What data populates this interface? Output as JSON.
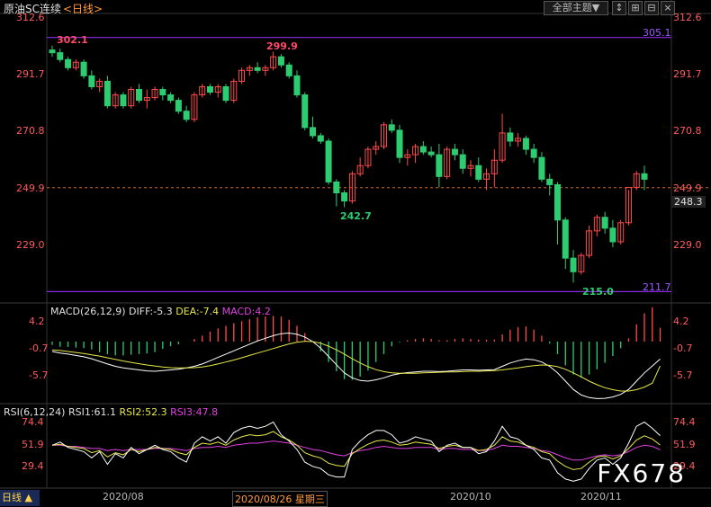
{
  "header": {
    "title": "原油SC连续",
    "period": "<日线>",
    "theme_button": "全部主题▼",
    "tool_icons": [
      "↕",
      "⊞",
      "⊟"
    ]
  },
  "price_panel": {
    "right_ticks": [
      "312.6",
      "291.7",
      "270.8",
      "249.9",
      "229.0"
    ],
    "left_ticks": [
      "312.6",
      "291.7",
      "270.8",
      "249.9",
      "229.0"
    ],
    "current_price_tag": "249.9",
    "last_price_tag": "248.3",
    "upper_line_label": "305.1",
    "lower_line_label": "211.7",
    "annotations": {
      "high1": "302.1",
      "high2": "299.9",
      "low1": "242.7",
      "low2": "215.0"
    }
  },
  "macd_panel": {
    "title": "MACD(26,12,9)",
    "diff": "DIFF:-5.3",
    "dea": "DEA:-7.4",
    "macd": "MACD:4.2",
    "ticks": [
      "4.2",
      "-0.7",
      "-5.7"
    ]
  },
  "rsi_panel": {
    "title": "RSI(6,12,24)",
    "rsi1": "RSI1:61.1",
    "rsi2": "RSI2:52.3",
    "rsi3": "RSI3:47.8",
    "ticks": [
      "74.4",
      "51.9",
      "29.4"
    ]
  },
  "footer": {
    "period_button": "日线 ▲",
    "dates": [
      "2020/08",
      "2020/08/26 星期三",
      "2020/10",
      "2020/11"
    ],
    "watermark": "FX678"
  },
  "colors": {
    "up": "#ff4a4a",
    "down": "#2ecc71",
    "diff": "#ffffff",
    "dea": "#e8e84a",
    "rsi3": "#e040e0",
    "line": "#8a2be2"
  },
  "chart_data": {
    "type": "candlestick",
    "title": "原油SC连续",
    "ylim": [
      205,
      315
    ],
    "candles": [
      [
        300.5,
        302.1,
        298,
        299.5
      ],
      [
        299.5,
        301,
        296,
        297
      ],
      [
        297,
        298,
        293,
        294
      ],
      [
        294,
        297,
        293,
        296
      ],
      [
        296,
        297,
        290,
        291
      ],
      [
        291,
        293,
        286,
        287
      ],
      [
        287,
        290,
        285,
        289
      ],
      [
        289,
        291,
        279,
        280
      ],
      [
        280,
        285,
        279,
        284
      ],
      [
        284,
        285,
        279,
        280
      ],
      [
        280,
        287,
        279,
        286
      ],
      [
        286,
        288,
        281,
        282
      ],
      [
        282,
        286,
        279,
        283
      ],
      [
        283,
        287,
        282,
        286
      ],
      [
        286,
        287,
        282,
        284
      ],
      [
        284,
        285,
        281,
        282
      ],
      [
        282,
        283,
        277,
        278
      ],
      [
        278,
        280,
        274,
        275
      ],
      [
        275,
        285,
        274,
        284
      ],
      [
        284,
        288,
        283,
        287
      ],
      [
        287,
        288,
        284,
        285
      ],
      [
        285,
        288,
        283,
        287
      ],
      [
        287,
        288,
        281,
        282
      ],
      [
        282,
        290,
        281,
        289
      ],
      [
        289,
        294,
        288,
        293
      ],
      [
        293,
        295,
        291,
        294
      ],
      [
        294,
        296,
        292,
        293
      ],
      [
        293,
        295,
        291,
        294
      ],
      [
        294,
        299.9,
        293,
        298
      ],
      [
        298,
        299,
        294,
        295
      ],
      [
        295,
        296,
        290,
        291
      ],
      [
        291,
        293,
        283,
        284
      ],
      [
        284,
        285,
        271,
        272
      ],
      [
        272,
        276,
        268,
        269
      ],
      [
        269,
        270,
        266,
        267
      ],
      [
        267,
        268,
        251,
        252
      ],
      [
        252,
        253,
        243,
        248
      ],
      [
        248,
        249,
        242.7,
        245
      ],
      [
        245,
        256,
        244,
        255
      ],
      [
        255,
        261,
        254,
        258
      ],
      [
        258,
        265,
        257,
        264
      ],
      [
        264,
        267,
        262,
        265
      ],
      [
        265,
        274,
        264,
        273
      ],
      [
        273,
        275,
        270,
        271
      ],
      [
        271,
        273,
        259,
        261
      ],
      [
        261,
        264,
        258,
        262
      ],
      [
        262,
        266,
        259,
        265
      ],
      [
        265,
        267,
        262,
        263
      ],
      [
        263,
        265,
        261,
        262
      ],
      [
        262,
        266,
        250,
        254
      ],
      [
        254,
        265,
        253,
        264
      ],
      [
        264,
        266,
        260,
        262
      ],
      [
        262,
        264,
        255,
        257
      ],
      [
        257,
        260,
        254,
        258
      ],
      [
        258,
        261,
        252,
        253
      ],
      [
        253,
        257,
        249,
        255
      ],
      [
        255,
        264,
        250,
        260
      ],
      [
        260,
        277,
        259,
        270
      ],
      [
        270,
        272,
        265,
        267
      ],
      [
        267,
        270,
        265,
        268
      ],
      [
        268,
        269,
        262,
        264
      ],
      [
        264,
        266,
        259,
        261
      ],
      [
        261,
        263,
        252,
        253
      ],
      [
        253,
        255,
        247,
        251
      ],
      [
        251,
        252,
        229,
        238
      ],
      [
        238,
        239,
        220,
        224
      ],
      [
        224,
        227,
        215,
        219
      ],
      [
        219,
        226,
        218,
        225
      ],
      [
        225,
        236,
        224,
        234
      ],
      [
        234,
        240,
        232,
        239
      ],
      [
        239,
        241,
        233,
        235
      ],
      [
        235,
        238,
        228,
        230
      ],
      [
        230,
        238,
        229,
        237
      ],
      [
        237,
        249,
        236,
        250
      ],
      [
        250,
        256,
        249,
        255
      ],
      [
        255,
        258,
        249,
        253
      ]
    ],
    "macd": {
      "diff": [
        -3.0,
        -3.5,
        -3.8,
        -4.2,
        -4.6,
        -5.2,
        -6.0,
        -6.8,
        -7.5,
        -8.0,
        -8.3,
        -8.6,
        -8.9,
        -9.0,
        -8.8,
        -8.6,
        -8.4,
        -8.0,
        -7.5,
        -6.8,
        -5.8,
        -4.8,
        -3.8,
        -2.8,
        -1.8,
        -0.8,
        0.2,
        1.0,
        1.8,
        2.4,
        2.6,
        2.2,
        1.4,
        0.0,
        -2.0,
        -4.5,
        -7.0,
        -9.5,
        -11.0,
        -11.8,
        -12.0,
        -11.6,
        -11.0,
        -10.2,
        -9.7,
        -9.4,
        -9.2,
        -9.0,
        -9.0,
        -9.1,
        -9.0,
        -8.8,
        -8.6,
        -8.6,
        -8.7,
        -8.6,
        -8.5,
        -7.5,
        -6.5,
        -5.8,
        -5.3,
        -5.5,
        -6.2,
        -7.5,
        -9.5,
        -12.0,
        -14.5,
        -16.2,
        -17.0,
        -17.3,
        -17.2,
        -16.8,
        -16.0,
        -14.5,
        -12.0,
        -9.5,
        -7.4,
        -5.3
      ],
      "dea": [
        -2.5,
        -2.7,
        -3.0,
        -3.3,
        -3.6,
        -4.0,
        -4.4,
        -4.9,
        -5.4,
        -5.9,
        -6.3,
        -6.7,
        -7.1,
        -7.4,
        -7.7,
        -7.9,
        -8.0,
        -8.0,
        -7.9,
        -7.7,
        -7.3,
        -6.8,
        -6.2,
        -5.6,
        -4.9,
        -4.2,
        -3.5,
        -2.8,
        -2.1,
        -1.4,
        -0.7,
        -0.2,
        0.1,
        0.0,
        -0.5,
        -1.4,
        -2.5,
        -3.8,
        -5.2,
        -6.5,
        -7.6,
        -8.5,
        -9.1,
        -9.5,
        -9.6,
        -9.6,
        -9.6,
        -9.5,
        -9.4,
        -9.3,
        -9.2,
        -9.2,
        -9.1,
        -9.0,
        -9.0,
        -8.9,
        -8.8,
        -8.6,
        -8.3,
        -8.0,
        -7.6,
        -7.3,
        -7.1,
        -7.2,
        -7.6,
        -8.4,
        -9.5,
        -10.7,
        -12.0,
        -13.1,
        -14.0,
        -14.6,
        -15.0,
        -15.0,
        -14.6,
        -13.8,
        -12.6,
        -7.4
      ],
      "hist": [
        -1.0,
        -1.6,
        -1.6,
        -1.8,
        -2.0,
        -2.4,
        -3.2,
        -3.8,
        -4.2,
        -4.2,
        -4.0,
        -3.8,
        -3.6,
        -3.2,
        -2.2,
        -1.4,
        -0.8,
        0.0,
        0.8,
        1.8,
        3.0,
        4.0,
        4.8,
        5.6,
        6.2,
        6.8,
        7.4,
        7.6,
        7.8,
        7.6,
        6.6,
        4.8,
        2.6,
        0.0,
        -3.0,
        -6.2,
        -9.0,
        -11.4,
        -11.6,
        -10.6,
        -8.8,
        -6.2,
        -3.8,
        -1.4,
        -0.2,
        0.4,
        0.8,
        1.0,
        0.8,
        0.4,
        0.4,
        0.8,
        1.0,
        0.8,
        0.6,
        0.6,
        0.6,
        2.2,
        3.6,
        4.4,
        4.6,
        3.6,
        1.8,
        -0.6,
        -3.8,
        -7.2,
        -10.0,
        -11.0,
        -10.0,
        -8.4,
        -6.4,
        -4.4,
        -2.0,
        1.0,
        5.2,
        8.6,
        10.4,
        4.2
      ]
    },
    "rsi": {
      "rsi1": [
        52,
        55,
        50,
        48,
        46,
        40,
        46,
        34,
        44,
        40,
        50,
        44,
        48,
        52,
        48,
        46,
        40,
        36,
        54,
        60,
        56,
        60,
        54,
        64,
        68,
        70,
        68,
        70,
        74,
        62,
        56,
        48,
        36,
        32,
        30,
        24,
        22,
        22,
        48,
        56,
        62,
        66,
        66,
        62,
        54,
        56,
        60,
        58,
        56,
        46,
        52,
        54,
        50,
        50,
        44,
        46,
        56,
        70,
        60,
        58,
        52,
        48,
        40,
        38,
        26,
        20,
        18,
        20,
        30,
        38,
        40,
        34,
        40,
        54,
        70,
        74,
        68,
        61.1
      ],
      "rsi2": [
        52,
        53,
        51,
        50,
        49,
        45,
        47,
        41,
        45,
        43,
        48,
        46,
        48,
        50,
        49,
        48,
        45,
        43,
        50,
        54,
        53,
        55,
        52,
        57,
        60,
        62,
        61,
        62,
        65,
        60,
        57,
        52,
        45,
        42,
        40,
        35,
        33,
        32,
        44,
        49,
        53,
        56,
        57,
        55,
        52,
        53,
        55,
        54,
        53,
        49,
        51,
        52,
        50,
        50,
        47,
        48,
        52,
        60,
        56,
        55,
        52,
        50,
        46,
        44,
        37,
        32,
        29,
        30,
        36,
        41,
        42,
        39,
        42,
        49,
        57,
        61,
        58,
        52.3
      ],
      "rsi3": [
        52,
        52,
        51,
        51,
        50,
        49,
        49,
        47,
        48,
        47,
        48,
        48,
        48,
        49,
        49,
        49,
        48,
        47,
        49,
        50,
        50,
        51,
        50,
        52,
        53,
        54,
        54,
        55,
        56,
        55,
        54,
        52,
        50,
        48,
        47,
        45,
        43,
        42,
        45,
        47,
        48,
        50,
        51,
        50,
        49,
        49,
        50,
        50,
        50,
        48,
        49,
        49,
        48,
        48,
        47,
        47,
        49,
        52,
        51,
        51,
        50,
        49,
        47,
        46,
        43,
        40,
        38,
        38,
        40,
        42,
        43,
        42,
        43,
        46,
        50,
        52,
        51,
        47.8
      ]
    }
  }
}
